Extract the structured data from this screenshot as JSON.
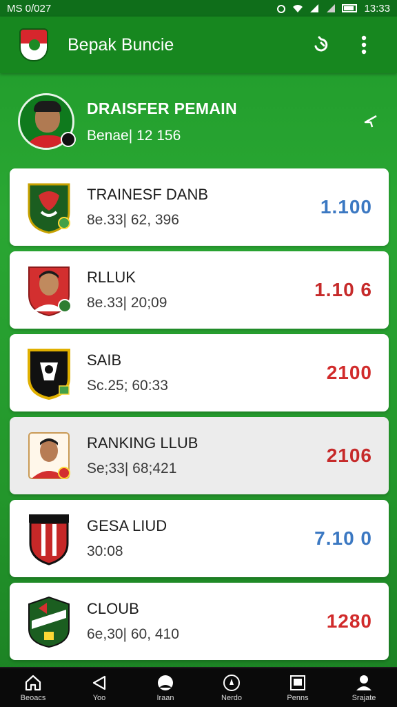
{
  "status_bar": {
    "time_left": "MS 0/027",
    "time_right": "13:33"
  },
  "app_bar": {
    "title": "Bepak Buncie"
  },
  "profile": {
    "name": "DRAISFER PEMAIN",
    "subtitle": "Benae| 12 156"
  },
  "clubs": [
    {
      "name": "TRAINESF DANB",
      "sub": "8e.33| 62, 396",
      "score": "1.100",
      "score_color": "#3b78c2",
      "crest": "green-shield"
    },
    {
      "name": "RLLUK",
      "sub": "8e.33| 20;09",
      "score": "1.10 6",
      "score_color": "#c62a2a",
      "crest": "player-red"
    },
    {
      "name": "SAIB",
      "sub": "Sc.25; 60:33",
      "score": "2100",
      "score_color": "#d12b2b",
      "crest": "black-shield"
    },
    {
      "name": "RANKING LLUB",
      "sub": "Se;33| 68;421",
      "score": "2106",
      "score_color": "#c62a2a",
      "crest": "player-white"
    },
    {
      "name": "GESA LIUD",
      "sub": "30:08",
      "score": "7.10 0",
      "score_color": "#3b78c2",
      "crest": "red-stripes"
    },
    {
      "name": "CLOUB",
      "sub": "6e,30| 60, 410",
      "score": "1280",
      "score_color": "#d12b2b",
      "crest": "green-emblem"
    }
  ],
  "bottom_nav": [
    {
      "label": "Beoacs",
      "icon": "home-icon"
    },
    {
      "label": "Yoo",
      "icon": "back-icon"
    },
    {
      "label": "Iraan",
      "icon": "ball-icon"
    },
    {
      "label": "Nerdo",
      "icon": "compass-icon"
    },
    {
      "label": "Penns",
      "icon": "document-icon"
    },
    {
      "label": "Srajate",
      "icon": "profile-icon"
    }
  ]
}
